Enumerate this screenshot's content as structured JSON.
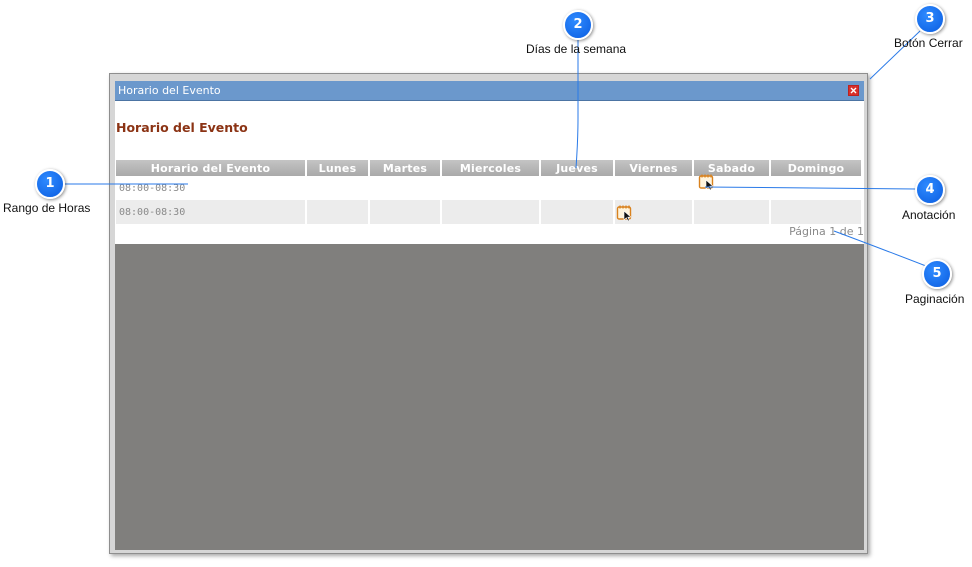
{
  "dialog": {
    "title": "Horario del Evento",
    "heading": "Horario del Evento",
    "close_icon": "close-x-icon",
    "columns": [
      "Horario del Evento",
      "Lunes",
      "Martes",
      "Miercoles",
      "Jueves",
      "Viernes",
      "Sabado",
      "Domingo"
    ],
    "rows": [
      {
        "time": "08:00-08:30",
        "annotation_day": "Sabado"
      },
      {
        "time": "08:00-08:30",
        "annotation_day": "Viernes"
      }
    ],
    "annotation_icon": "calendar-note-icon",
    "pagination": "Página 1 de 1"
  },
  "callouts": [
    {
      "number": "1",
      "label": "Rango de Horas"
    },
    {
      "number": "2",
      "label": "Días de la semana"
    },
    {
      "number": "3",
      "label": "Botón Cerrar"
    },
    {
      "number": "4",
      "label": "Anotación"
    },
    {
      "number": "5",
      "label": "Paginación"
    }
  ],
  "colors": {
    "titlebar": "#6b98cc",
    "heading": "#8b3314",
    "header_cell": "#b3b3b3",
    "gray_area": "#807f7d",
    "callout_badge": "#0a6cf0"
  }
}
